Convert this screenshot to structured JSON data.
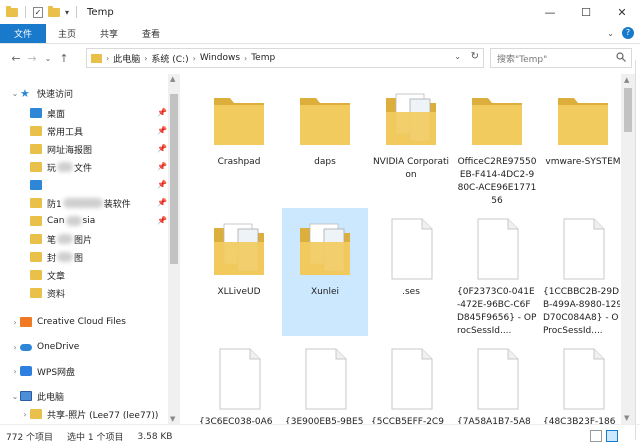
{
  "titlebar": {
    "title": "Temp",
    "minimize": "—",
    "maximize": "☐",
    "close": "✕"
  },
  "ribbon": {
    "tabs": [
      "文件",
      "主页",
      "共享",
      "查看"
    ],
    "help": "?"
  },
  "address": {
    "crumbs": [
      "此电脑",
      "系统 (C:)",
      "Windows",
      "Temp"
    ],
    "search_placeholder": "搜索\"Temp\""
  },
  "nav": {
    "items": [
      {
        "label": "快速访问"
      },
      {
        "label": "桌面"
      },
      {
        "label": "常用工具"
      },
      {
        "label": "网址海报图"
      },
      {
        "label": "玩",
        "suffix": "文件"
      },
      {
        "label": ""
      },
      {
        "label": "防1",
        "suffix": "装软件"
      },
      {
        "label": "Can",
        "suffix": "sia"
      },
      {
        "label": "笔",
        "suffix": "图片"
      },
      {
        "label": "封",
        "suffix": "图"
      },
      {
        "label": "文章"
      },
      {
        "label": "资料"
      },
      {
        "label": "Creative Cloud Files"
      },
      {
        "label": "OneDrive"
      },
      {
        "label": "WPS网盘"
      },
      {
        "label": "此电脑"
      },
      {
        "label": "共享-照片 (Lee77 (lee77))"
      }
    ]
  },
  "files": [
    {
      "name": "Crashpad",
      "icon": "folder-icon"
    },
    {
      "name": "daps",
      "icon": "folder-icon"
    },
    {
      "name": "NVIDIA Corporation",
      "icon": "folder-with-docs-icon"
    },
    {
      "name": "OfficeC2RE97550EB-F414-4DC2-980C-ACE96E177156",
      "icon": "folder-icon"
    },
    {
      "name": "vmware-SYSTEM",
      "icon": "folder-icon"
    },
    {
      "name": "XLLiveUD",
      "icon": "folder-with-docs-icon"
    },
    {
      "name": "Xunlei",
      "icon": "folder-with-docs-icon"
    },
    {
      "name": ".ses",
      "icon": "file-icon"
    },
    {
      "name": "{0F2373C0-041E-472E-96BC-C6FD845F9656} - OProcSessId....",
      "icon": "file-icon"
    },
    {
      "name": "{1CCBBC2B-29DB-499A-8980-129D70C084A8} - OProcSessId....",
      "icon": "file-icon"
    },
    {
      "name": "{3C6EC038-0A6",
      "icon": "file-icon"
    },
    {
      "name": "{3E900EB5-9BE5",
      "icon": "file-icon"
    },
    {
      "name": "{5CCB5EFF-2C9",
      "icon": "file-icon"
    },
    {
      "name": "{7A58A1B7-5A8",
      "icon": "file-icon"
    },
    {
      "name": "{48C3B23F-186",
      "icon": "file-icon"
    }
  ],
  "status": {
    "count": "772 个项目",
    "selection": "选中 1 个项目",
    "size": "3.58 KB"
  },
  "colors": {
    "accent": "#1979ca",
    "folder": "#e8c04a",
    "selected": "#cce8ff"
  }
}
